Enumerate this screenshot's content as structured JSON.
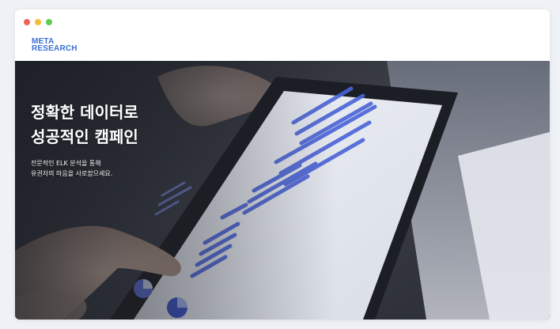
{
  "logo": {
    "line1": "META",
    "line2": "RESEARCH"
  },
  "hero": {
    "headline_line1": "정확한 데이터로",
    "headline_line2": "성공적인 캠페인",
    "subtext_line1": "전문적인 ELK 분석을 통해",
    "subtext_line2": "유권자의 마음을 사로잡으세요."
  },
  "colors": {
    "brand": "#3b6fd4",
    "close": "#f0605c",
    "minimize": "#f2bc3c",
    "maximize": "#5fcb50"
  }
}
